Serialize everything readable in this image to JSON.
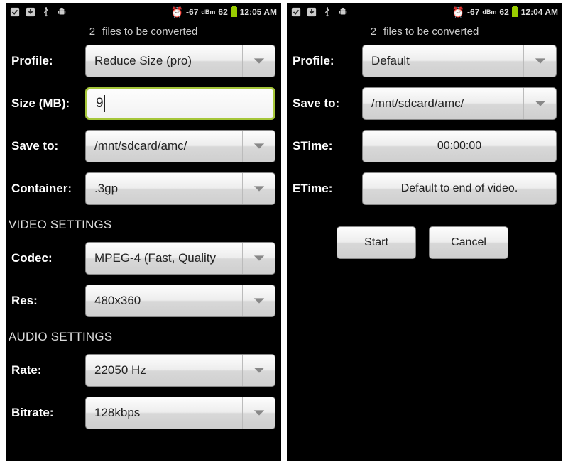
{
  "left": {
    "status": {
      "signal": "-67",
      "dbm": "dBm",
      "battery": "62",
      "time": "12:05 AM"
    },
    "subheader": {
      "count": "2",
      "text": "files to be converted"
    },
    "labels": {
      "profile": "Profile:",
      "size": "Size (MB):",
      "saveto": "Save to:",
      "container": "Container:",
      "video_section": "VIDEO SETTINGS",
      "codec": "Codec:",
      "res": "Res:",
      "audio_section": "AUDIO SETTINGS",
      "rate": "Rate:",
      "bitrate": "Bitrate:"
    },
    "values": {
      "profile": "Reduce Size (pro)",
      "size": "9",
      "saveto": "/mnt/sdcard/amc/",
      "container": ".3gp",
      "codec": "MPEG-4 (Fast, Quality",
      "res": "480x360",
      "rate": "22050 Hz",
      "bitrate": "128kbps"
    }
  },
  "right": {
    "status": {
      "signal": "-67",
      "dbm": "dBm",
      "battery": "62",
      "time": "12:04 AM"
    },
    "subheader": {
      "count": "2",
      "text": "files to be converted"
    },
    "labels": {
      "profile": "Profile:",
      "saveto": "Save to:",
      "stime": "STime:",
      "etime": "ETime:"
    },
    "values": {
      "profile": "Default",
      "saveto": "/mnt/sdcard/amc/",
      "stime": "00:00:00",
      "etime": "Default to end of video."
    },
    "buttons": {
      "start": "Start",
      "cancel": "Cancel"
    }
  }
}
